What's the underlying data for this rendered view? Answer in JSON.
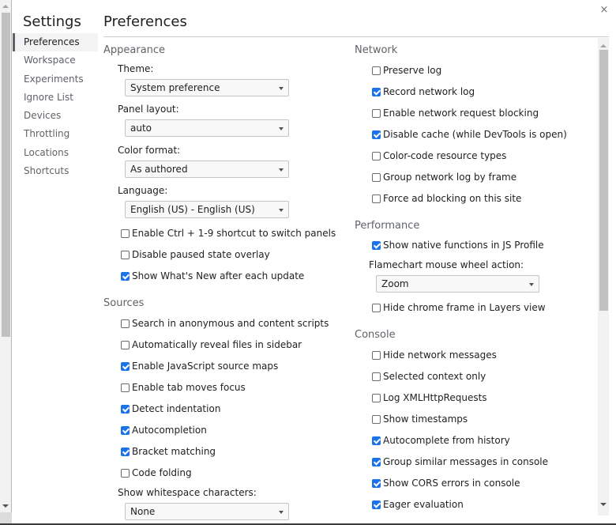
{
  "window": {
    "close_label": "×"
  },
  "sidebar": {
    "title": "Settings",
    "items": [
      {
        "label": "Preferences",
        "selected": true
      },
      {
        "label": "Workspace",
        "selected": false
      },
      {
        "label": "Experiments",
        "selected": false
      },
      {
        "label": "Ignore List",
        "selected": false
      },
      {
        "label": "Devices",
        "selected": false
      },
      {
        "label": "Throttling",
        "selected": false
      },
      {
        "label": "Locations",
        "selected": false
      },
      {
        "label": "Shortcuts",
        "selected": false
      }
    ]
  },
  "main": {
    "title": "Preferences",
    "appearance": {
      "title": "Appearance",
      "theme": {
        "label": "Theme:",
        "value": "System preference"
      },
      "panel_layout": {
        "label": "Panel layout:",
        "value": "auto"
      },
      "color_format": {
        "label": "Color format:",
        "value": "As authored"
      },
      "language": {
        "label": "Language:",
        "value": "English (US) - English (US)"
      },
      "checkboxes": [
        {
          "label": "Enable Ctrl + 1-9 shortcut to switch panels",
          "checked": false
        },
        {
          "label": "Disable paused state overlay",
          "checked": false
        },
        {
          "label": "Show What's New after each update",
          "checked": true
        }
      ]
    },
    "sources": {
      "title": "Sources",
      "checkboxes": [
        {
          "label": "Search in anonymous and content scripts",
          "checked": false
        },
        {
          "label": "Automatically reveal files in sidebar",
          "checked": false
        },
        {
          "label": "Enable JavaScript source maps",
          "checked": true
        },
        {
          "label": "Enable tab moves focus",
          "checked": false
        },
        {
          "label": "Detect indentation",
          "checked": true
        },
        {
          "label": "Autocompletion",
          "checked": true
        },
        {
          "label": "Bracket matching",
          "checked": true
        },
        {
          "label": "Code folding",
          "checked": false
        }
      ],
      "whitespace": {
        "label": "Show whitespace characters:",
        "value": "None"
      }
    },
    "network": {
      "title": "Network",
      "checkboxes": [
        {
          "label": "Preserve log",
          "checked": false
        },
        {
          "label": "Record network log",
          "checked": true
        },
        {
          "label": "Enable network request blocking",
          "checked": false
        },
        {
          "label": "Disable cache (while DevTools is open)",
          "checked": true
        },
        {
          "label": "Color-code resource types",
          "checked": false
        },
        {
          "label": "Group network log by frame",
          "checked": false
        },
        {
          "label": "Force ad blocking on this site",
          "checked": false
        }
      ]
    },
    "performance": {
      "title": "Performance",
      "native_functions": {
        "label": "Show native functions in JS Profile",
        "checked": true
      },
      "flamechart": {
        "label": "Flamechart mouse wheel action:",
        "value": "Zoom"
      },
      "hide_chrome_frame": {
        "label": "Hide chrome frame in Layers view",
        "checked": false
      }
    },
    "console": {
      "title": "Console",
      "checkboxes": [
        {
          "label": "Hide network messages",
          "checked": false
        },
        {
          "label": "Selected context only",
          "checked": false
        },
        {
          "label": "Log XMLHttpRequests",
          "checked": false
        },
        {
          "label": "Show timestamps",
          "checked": false
        },
        {
          "label": "Autocomplete from history",
          "checked": true
        },
        {
          "label": "Group similar messages in console",
          "checked": true
        },
        {
          "label": "Show CORS errors in console",
          "checked": true
        },
        {
          "label": "Eager evaluation",
          "checked": true
        }
      ]
    }
  },
  "colors": {
    "accent": "#1a73e8",
    "section_title": "#5f6368",
    "text": "#202124"
  }
}
